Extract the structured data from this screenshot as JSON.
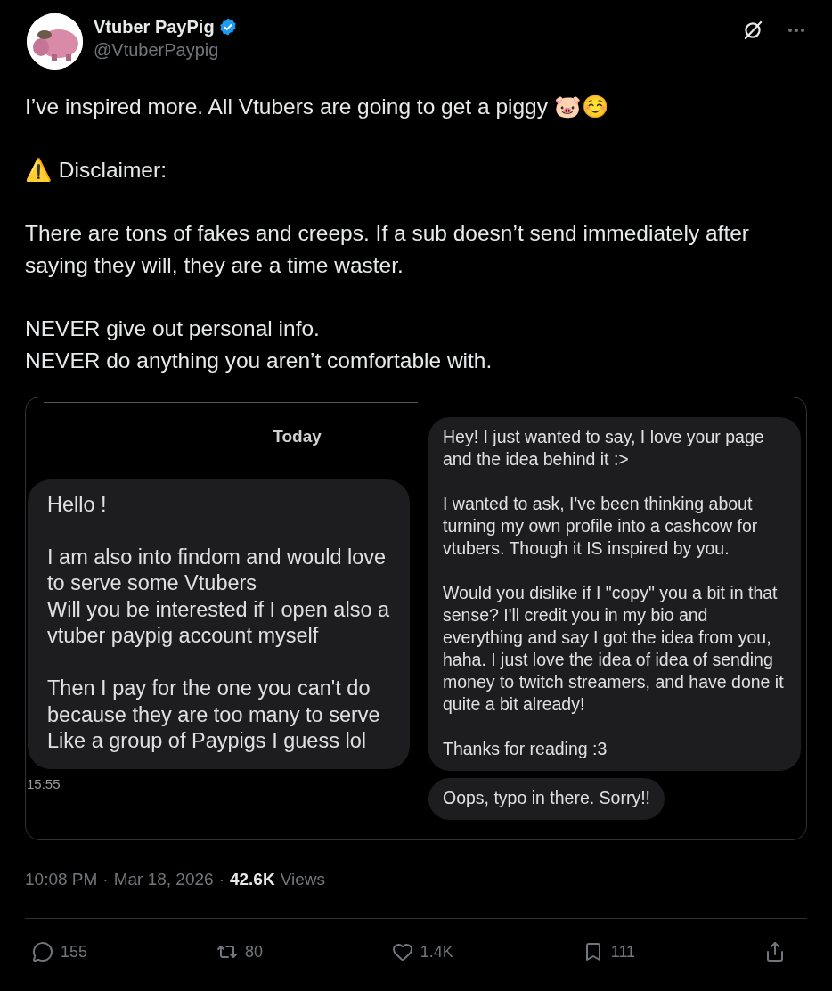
{
  "author": {
    "name": "Vtuber PayPig",
    "handle": "@VtuberPaypig",
    "verified": true
  },
  "body": [
    "I’ve inspired more. All Vtubers are going to get a piggy 🐷☺️",
    "⚠️ Disclaimer:",
    "There are tons of fakes and creeps. If a sub doesn’t send immediately after saying they will, they are a time waster.",
    "NEVER give out personal info.\nNEVER do anything you aren’t comfortable with."
  ],
  "media": {
    "left": {
      "day": "Today",
      "message": "Hello !\n\nI am also into findom and would love to serve some Vtubers\nWill you be interested if I open also a vtuber paypig account myself\n\nThen I pay for the one you can't do because they are too many to serve\nLike a group of Paypigs I guess lol",
      "time": "15:55"
    },
    "right": {
      "messages": [
        "Hey! I just wanted to say, I love your page and the idea behind it :>\n\nI wanted to ask, I've been thinking about turning my own profile into a cashcow for vtubers. Though it IS inspired by you.\n\nWould you dislike if I \"copy\" you a bit in that sense? I'll credit you in my bio and everything and say I got the idea from you, haha. I just love the idea of idea of sending money to twitch streamers, and have done it quite a bit already!\n\nThanks for reading :3",
        "Oops, typo in there. Sorry!!"
      ]
    }
  },
  "meta": {
    "time": "10:08 PM",
    "sep": "·",
    "date": "Mar 18, 2026",
    "sep2": "·",
    "views": "42.6K",
    "views_label": "Views"
  },
  "actions": [
    {
      "kind": "reply",
      "count": "155"
    },
    {
      "kind": "repost",
      "count": "80"
    },
    {
      "kind": "like",
      "count": "1.4K"
    },
    {
      "kind": "bookmark",
      "count": "111"
    },
    {
      "kind": "share"
    }
  ]
}
